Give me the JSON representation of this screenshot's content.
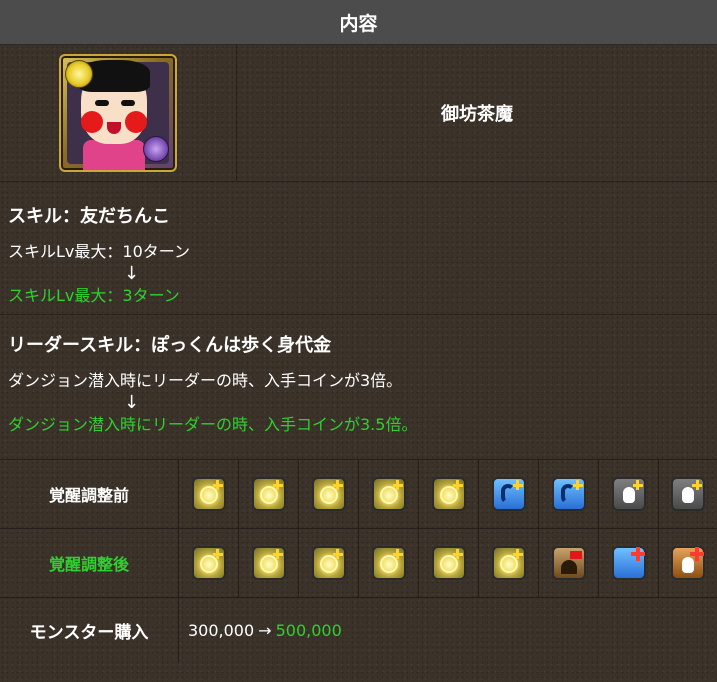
{
  "header": {
    "title": "内容"
  },
  "monster": {
    "name": "御坊茶魔",
    "icon": "monster-portrait"
  },
  "skill": {
    "title": "スキル：友だちんこ",
    "before": "スキルLv最大：10ターン",
    "arrow": "↓",
    "after": "スキルLv最大：3ターン"
  },
  "leader_skill": {
    "title": "リーダースキル：ぽっくんは歩く身代金",
    "before": "ダンジョン潜入時にリーダーの時、入手コインが3倍。",
    "arrow": "↓",
    "after": "ダンジョン潜入時にリーダーの時、入手コインが3.5倍。"
  },
  "awakenings_before": {
    "label": "覚醒調整前",
    "items": [
      "coin-plus-icon",
      "coin-plus-icon",
      "coin-plus-icon",
      "coin-plus-icon",
      "coin-plus-icon",
      "skill-boost-icon",
      "skill-boost-icon",
      "finger-icon",
      "finger-icon"
    ]
  },
  "awakenings_after": {
    "label": "覚醒調整後",
    "items": [
      "coin-plus-icon",
      "coin-plus-icon",
      "coin-plus-icon",
      "coin-plus-icon",
      "coin-plus-icon",
      "coin-plus-icon",
      "dungeon-bonus-icon",
      "skill-boost-plus-icon",
      "finger-plus-icon"
    ]
  },
  "purchase": {
    "label": "モンスター購入",
    "before": "300,000",
    "arrow": "→",
    "after": "500,000"
  },
  "colors": {
    "highlight": "#2fd12f",
    "header_bg": "#4c4c4c",
    "page_bg": "#3b3229"
  }
}
